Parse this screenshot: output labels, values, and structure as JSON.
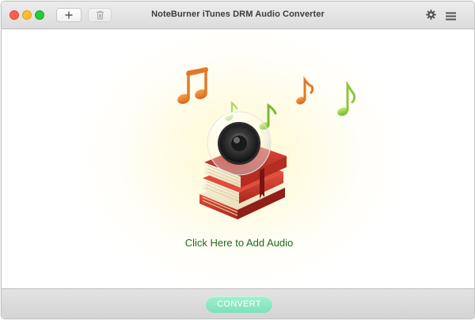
{
  "window": {
    "title": "NoteBurner iTunes DRM Audio Converter",
    "controls": [
      "close",
      "minimize",
      "maximize"
    ]
  },
  "toolbar": {
    "add_icon": "plus-icon",
    "delete_icon": "trash-icon",
    "settings_icon": "gear-icon",
    "menu_icon": "hamburger-menu-icon"
  },
  "main": {
    "add_audio_label": "Click Here to Add Audio",
    "illustration": "books-speaker-music-notes"
  },
  "footer": {
    "convert_label": "CONVERT"
  },
  "colors": {
    "label_green": "#1e6a1e",
    "convert_button": "#8ee8c7",
    "glow_yellow": "#fffbd2"
  }
}
